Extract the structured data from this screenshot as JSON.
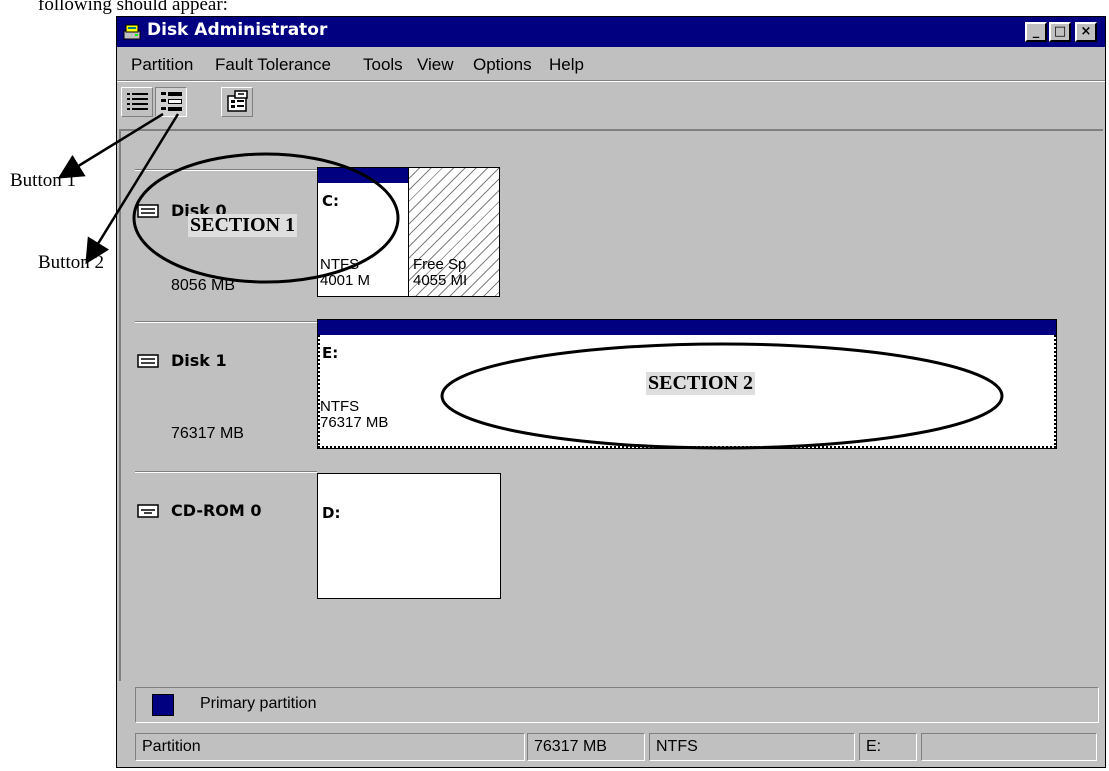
{
  "caption": "following should appear:",
  "window": {
    "title": "Disk Administrator",
    "controls": [
      "_",
      "□",
      "×"
    ]
  },
  "menu": [
    "Partition",
    "Fault Tolerance",
    "Tools",
    "View",
    "Options",
    "Help"
  ],
  "toolbar": {
    "buttons": [
      {
        "icon": "volumes-view-icon",
        "state": "raised"
      },
      {
        "icon": "disk-configuration-view-icon",
        "state": "pressed"
      },
      {
        "icon": "properties-icon",
        "state": "raised"
      }
    ]
  },
  "disks": [
    {
      "name": "Disk 0",
      "size": "8056 MB",
      "partitions": [
        {
          "letter": "C:",
          "fs": "NTFS",
          "size": "4001 M",
          "type": "primary"
        },
        {
          "label": "Free Sp",
          "size": "4055 MI",
          "type": "free"
        }
      ]
    },
    {
      "name": "Disk 1",
      "size": "76317 MB",
      "partitions": [
        {
          "letter": "E:",
          "fs": "NTFS",
          "size": "76317 MB",
          "type": "primary",
          "selected": true
        }
      ]
    },
    {
      "name": "CD-ROM 0",
      "size": "",
      "partitions": [
        {
          "letter": "D:",
          "type": "cdrom"
        }
      ]
    }
  ],
  "legend": {
    "label": "Primary partition",
    "color": "#000080"
  },
  "status": {
    "type": "Partition",
    "size": "76317 MB",
    "fs": "NTFS",
    "letter": "E:",
    "extra": ""
  },
  "annotations": {
    "button1": "Button 1",
    "button2": "Button 2",
    "section1": "SECTION 1",
    "section2": "SECTION 2"
  }
}
